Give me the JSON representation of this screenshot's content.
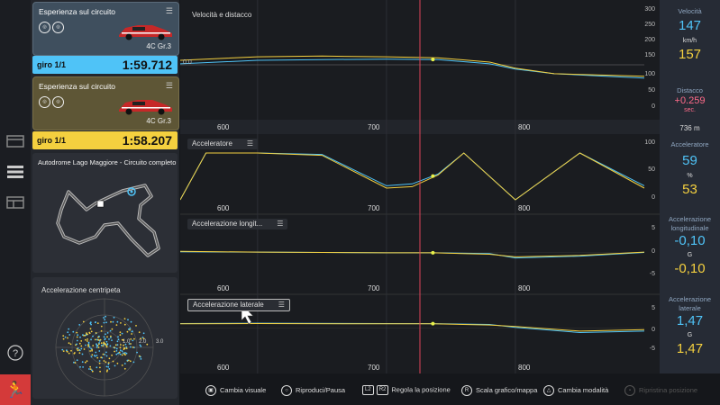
{
  "laps": [
    {
      "title": "Esperienza sul circuito",
      "car": "4C Gr.3",
      "lap_label": "giro 1/1",
      "lap_time": "1:59.712",
      "color": "#4fc3f7",
      "card_bg": "#3f4f5e"
    },
    {
      "title": "Esperienza sul circuito",
      "car": "4C Gr.3",
      "lap_label": "giro 1/1",
      "lap_time": "1:58.207",
      "color": "#f4d03f",
      "card_bg": "#5e5636"
    }
  ],
  "track": {
    "name": "Autodrome Lago Maggiore - Circuito completo"
  },
  "centripetal": {
    "title": "Accelerazione centripeta",
    "ring_labels": [
      "1.0",
      "2.0",
      "3.0"
    ]
  },
  "charts": {
    "x_ticks": [
      "600",
      "700",
      "800"
    ],
    "speed": {
      "title": "Velocità e distacco",
      "y_ticks": [
        "300",
        "250",
        "200",
        "150",
        "100",
        "50",
        "0"
      ],
      "gap_zero": "0.0"
    },
    "throttle": {
      "title": "Acceleratore",
      "y_ticks": [
        "100",
        "50",
        "0"
      ]
    },
    "long_acc": {
      "title": "Accelerazione longit...",
      "y_ticks": [
        "5",
        "0",
        "-5"
      ]
    },
    "lat_acc": {
      "title": "Accelerazione laterale",
      "y_ticks": [
        "5",
        "0",
        "-5"
      ]
    },
    "distance_marker": "736 m"
  },
  "chart_data": [
    {
      "type": "line",
      "title": "Velocità e distacco",
      "x": [
        540,
        600,
        650,
        700,
        740,
        780,
        800,
        830,
        870,
        900
      ],
      "series": [
        {
          "values": [
            140,
            150,
            152,
            153,
            152,
            140,
            125,
            112,
            105,
            100
          ]
        },
        {
          "values": [
            150,
            160,
            162,
            160,
            157,
            145,
            128,
            112,
            108,
            105
          ]
        }
      ],
      "xlabel": "",
      "ylabel": "",
      "ylim": [
        0,
        300
      ]
    },
    {
      "type": "line",
      "title": "Acceleratore",
      "x": [
        540,
        560,
        600,
        650,
        700,
        720,
        740,
        760,
        800,
        850,
        900
      ],
      "series": [
        {
          "values": [
            0,
            100,
            100,
            97,
            30,
            34,
            55,
            100,
            0,
            100,
            30
          ]
        },
        {
          "values": [
            0,
            100,
            100,
            95,
            25,
            28,
            53,
            100,
            0,
            100,
            25
          ]
        }
      ],
      "xlabel": "",
      "ylabel": "",
      "ylim": [
        0,
        100
      ]
    },
    {
      "type": "line",
      "title": "Accelerazione longit...",
      "x": [
        540,
        600,
        700,
        736,
        780,
        800,
        850,
        900
      ],
      "series": [
        {
          "values": [
            0.2,
            0.1,
            -0.1,
            -0.1,
            -0.3,
            -1.5,
            -1.0,
            0.0
          ]
        },
        {
          "values": [
            0.3,
            0.1,
            -0.1,
            -0.1,
            -0.5,
            -1.2,
            -0.8,
            0.1
          ]
        }
      ],
      "xlabel": "",
      "ylabel": "",
      "ylim": [
        -7,
        7
      ]
    },
    {
      "type": "line",
      "title": "Accelerazione laterale",
      "x": [
        540,
        600,
        700,
        736,
        780,
        800,
        850,
        900
      ],
      "series": [
        {
          "values": [
            1.5,
            1.6,
            1.5,
            1.47,
            1.2,
            0.2,
            -1.5,
            -1.0
          ]
        },
        {
          "values": [
            1.4,
            1.5,
            1.4,
            1.39,
            1.0,
            0.5,
            -1.0,
            -0.5
          ]
        }
      ],
      "xlabel": "",
      "ylabel": "",
      "ylim": [
        -7,
        7
      ]
    }
  ],
  "readout": {
    "speed": {
      "title": "Velocità",
      "value_a": "147",
      "unit": "km/h",
      "value_b": "157"
    },
    "gap": {
      "title": "Distacco",
      "value": "+0.259",
      "unit": "sec."
    },
    "distance": "736 m",
    "throttle": {
      "title": "Acceleratore",
      "value_a": "59",
      "unit": "%",
      "value_b": "53"
    },
    "long_acc": {
      "title": "Accelerazione longitudinale",
      "value_a": "-0,10",
      "unit": "G",
      "value_b": "-0,10"
    },
    "lat_acc": {
      "title": "Accelerazione laterale",
      "value_a": "1,47",
      "unit": "G",
      "value_b": "1,47"
    }
  },
  "hints": [
    {
      "glyph": "touchpad-icon",
      "label": "Cambia visuale"
    },
    {
      "glyph": "circle-icon",
      "label": "Riproduci/Pausa"
    },
    {
      "glyph": "L2-R2",
      "key1": "L2",
      "key2": "R2",
      "label": "Regola la posizione"
    },
    {
      "glyph": "R-stick-icon",
      "key": "R",
      "label": "Scala grafico/mappa"
    },
    {
      "glyph": "triangle-icon",
      "label": "Cambia modalità"
    },
    {
      "glyph": "options-icon",
      "label": "Ripristina posizione"
    }
  ],
  "colors": {
    "lap_a": "#4fc3f7",
    "lap_b": "#f4d03f",
    "cursor": "#e0455a",
    "gap": "#ff6b8a"
  }
}
